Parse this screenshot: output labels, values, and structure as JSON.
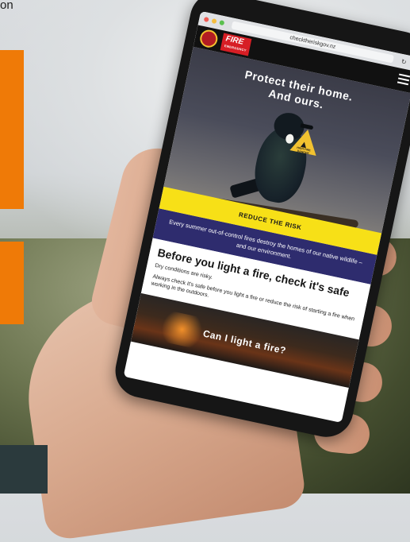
{
  "page_fragment": {
    "top_text": "on"
  },
  "browser": {
    "url": "checktheriskgov.nz",
    "reload_icon": "reload-icon",
    "share_icon": "share-icon"
  },
  "site": {
    "logo_text": "FIRE",
    "logo_subtext": "EMERGENCY"
  },
  "hero": {
    "title_line1": "Protect their home.",
    "title_line2": "And ours.",
    "warning_text": "HIGH FIRE DANGER",
    "cta_label": "REDUCE THE RISK"
  },
  "band": {
    "text": "Every summer out-of-control fires destroy the homes of our native wildlife – and our environment."
  },
  "section": {
    "title": "Before you light a fire, check it's safe",
    "p1": "Dry conditions are risky.",
    "p2": "Always check it's safe before you light a fire or reduce the risk of starting a fire when working in the outdoors."
  },
  "fire_section": {
    "title": "Can I light a fire?"
  },
  "colors": {
    "orange_accent": "#ef7a07",
    "cta_yellow": "#f7e017",
    "band_navy": "#2e2c6e",
    "logo_red": "#d71e25"
  }
}
